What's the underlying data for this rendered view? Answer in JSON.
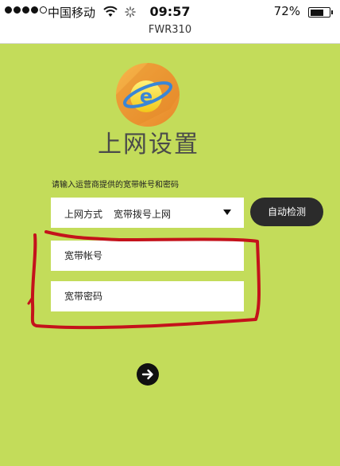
{
  "status_bar": {
    "carrier": "中国移动",
    "time": "09:57",
    "battery": "72%",
    "battery_level": 0.72,
    "icons": [
      "signal-dots-icon",
      "wifi-icon",
      "loading-spinner-icon",
      "battery-icon"
    ]
  },
  "subtitle": "FWR310",
  "page": {
    "title": "上网设置",
    "logo_icon": "globe-e-logo-icon",
    "hint": "请输入运营商提供的宽带帐号和密码",
    "method": {
      "label": "上网方式",
      "value": "宽带拨号上网"
    },
    "auto_detect_label": "自动检测",
    "account_placeholder": "宽带帐号",
    "password_placeholder": "宽带密码",
    "next_icon": "arrow-right-icon"
  },
  "colors": {
    "background": "#c3dc5a",
    "annotation": "#c4121b",
    "button": "#2b2b2b",
    "logo_orange": "#f2a13a"
  }
}
